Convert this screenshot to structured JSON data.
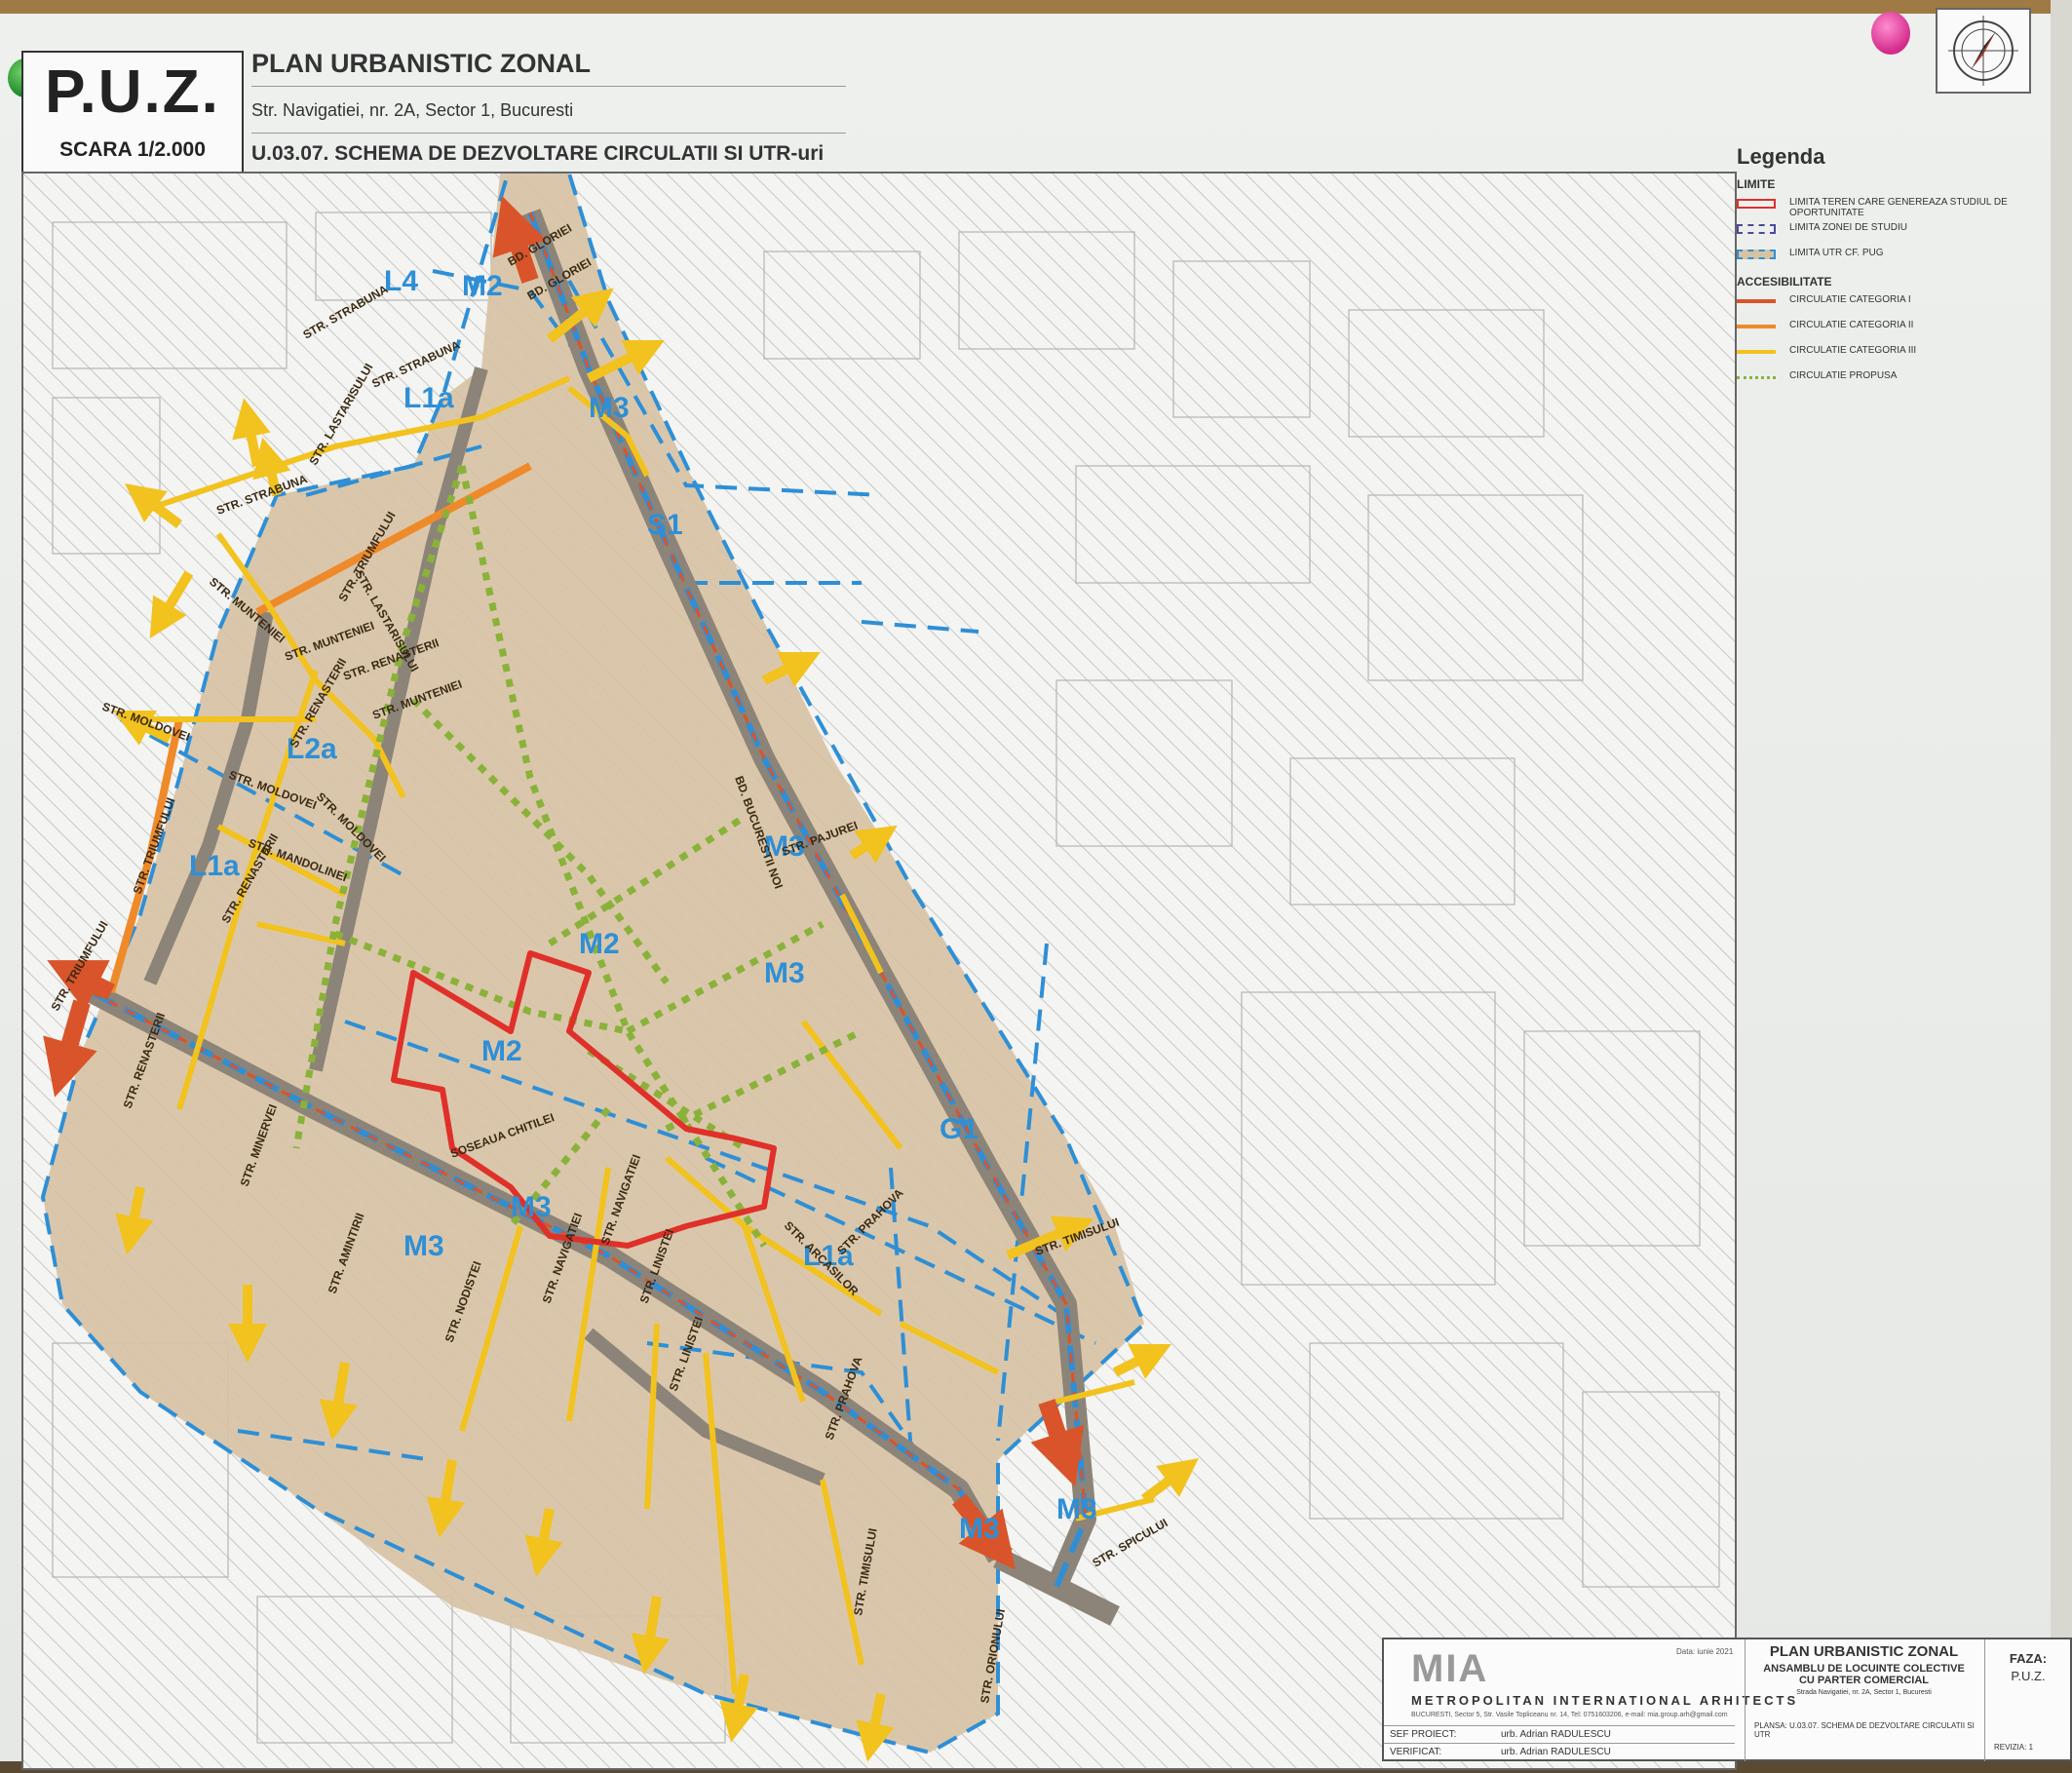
{
  "header": {
    "puz": "P.U.Z.",
    "scale": "SCARA 1/2.000",
    "title": "PLAN URBANISTIC ZONAL",
    "address": "Str. Navigatiei, nr. 2A, Sector 1, Bucuresti",
    "sheet_title": "U.03.07. SCHEMA DE DEZVOLTARE CIRCULATII SI UTR-uri"
  },
  "legend": {
    "title": "Legenda",
    "sections": [
      {
        "name": "LIMITE",
        "items": [
          {
            "label": "LIMITA TEREN CARE GENEREAZA STUDIUL DE OPORTUNITATE",
            "style": "solid",
            "color": "#e0302a"
          },
          {
            "label": "LIMITA ZONEI DE STUDIU",
            "style": "dashed",
            "color": "#4a4a9a"
          },
          {
            "label": "LIMITA UTR cf. PUG",
            "style": "dashed-blue",
            "color": "#2e8fd6"
          }
        ]
      },
      {
        "name": "ACCESIBILITATE",
        "items": [
          {
            "label": "CIRCULATIE CATEGORIA I",
            "style": "arrow",
            "color": "#d9542a"
          },
          {
            "label": "CIRCULATIE CATEGORIA II",
            "style": "arrow",
            "color": "#ef8a2a"
          },
          {
            "label": "CIRCULATIE CATEGORIA III",
            "style": "arrow",
            "color": "#f2c21e"
          },
          {
            "label": "CIRCULATIE PROPUSA",
            "style": "dotted",
            "color": "#8ab23a"
          }
        ]
      }
    ]
  },
  "zones": [
    {
      "code": "L4"
    },
    {
      "code": "M2"
    },
    {
      "code": "M3"
    },
    {
      "code": "L1a"
    },
    {
      "code": "S1"
    },
    {
      "code": "L2a"
    },
    {
      "code": "L1a"
    },
    {
      "code": "M3"
    },
    {
      "code": "M2"
    },
    {
      "code": "M3"
    },
    {
      "code": "M2"
    },
    {
      "code": "G1"
    },
    {
      "code": "M3"
    },
    {
      "code": "M3"
    },
    {
      "code": "L1a"
    },
    {
      "code": "M3"
    },
    {
      "code": "M3"
    }
  ],
  "streets": [
    "BD. GLORIEI",
    "BD. GLORIEI",
    "STR. STRABUNA",
    "STR. STRABUNA",
    "STR. STRABUNA",
    "STR. LASTARISULUI",
    "STR. TRIUMFULUI",
    "STR. LASTARISULUI",
    "STR. MUNTENIEI",
    "STR. MUNTENIEI",
    "STR. RENASTERII",
    "STR. MUNTENIEI",
    "STR. MOLDOVEI",
    "STR. RENASTERII",
    "STR. MOLDOVEI",
    "STR. MOLDOVEI",
    "STR. TRIUMFULUI",
    "STR. RENASTERII",
    "STR. MANDOLINEI",
    "BD. BUCURESTII NOI",
    "STR. PAJUREI",
    "STR. TRIUMFULUI",
    "STR. RENASTERII",
    "STR. MINERVEI",
    "STR. AMINTIRII",
    "SOSEAUA CHITILEI",
    "STR. NODISTEI",
    "STR. NAVIGATIEI",
    "STR. NAVIGATIEI",
    "STR. LINISTEI",
    "STR. LINISTEI",
    "STR. ARCASILOR",
    "STR. PRAHOVA",
    "STR. PRAHOVA",
    "STR. TIMISULUI",
    "STR. SPICULUI",
    "STR. TIMISULUI",
    "STR. ORIONULUI"
  ],
  "cartouche": {
    "logo": "MIA",
    "firm": "METROPOLITAN INTERNATIONAL ARHITECTS",
    "address": "BUCURESTI, Sector 5, Str. Vasile Topliceanu nr. 14, Tel: 0751603206, e-mail: mia.group.arh@gmail.com",
    "date": "Data: iunie 2021",
    "rows": [
      {
        "role": "SEF PROIECT:",
        "name": "urb. Adrian RADULESCU"
      },
      {
        "role": "VERIFICAT:",
        "name": "urb. Adrian RADULESCU"
      }
    ],
    "plan_title": "PLAN URBANISTIC ZONAL",
    "project": "ANSAMBLU DE LOCUINTE COLECTIVE CU PARTER COMERCIAL",
    "project_address": "Strada Navigatiei, nr. 2A, Sector 1, Bucuresti",
    "plansa": "PLANSA: U.03.07. SCHEMA DE DEZVOLTARE CIRCULATII SI UTR",
    "faza_label": "FAZA:",
    "faza_value": "P.U.Z.",
    "revizia": "REVIZIA: 1"
  },
  "colors": {
    "zone_fill": "#d7c2a3",
    "road_main": "#8c8478",
    "cat1": "#d9542a",
    "cat2": "#ef8a2a",
    "cat3": "#f2c21e",
    "proposed": "#8ab23a",
    "utr": "#2e8fd6",
    "site": "#e0302a"
  }
}
